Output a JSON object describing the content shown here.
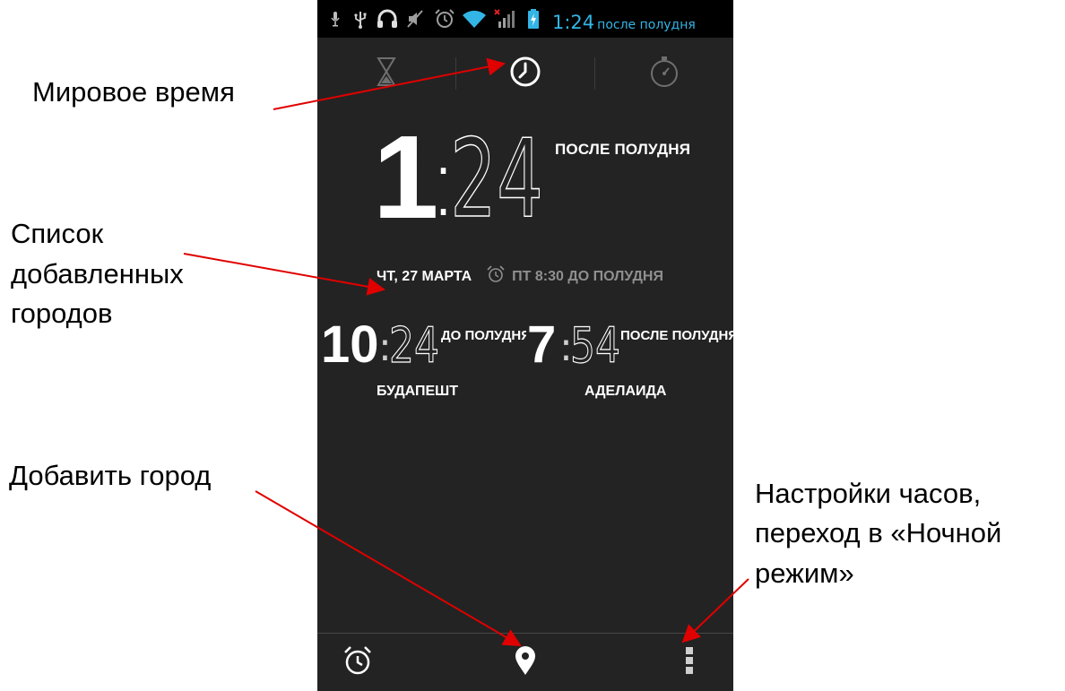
{
  "status_bar": {
    "time": "1:24",
    "ampm": "после полудня",
    "icons": [
      "mic-icon",
      "usb-icon",
      "headphones-icon",
      "mute-icon",
      "alarm-icon",
      "wifi-icon",
      "signal-icon",
      "battery-icon"
    ]
  },
  "tabs": [
    {
      "name": "timer",
      "icon": "hourglass-icon"
    },
    {
      "name": "clock",
      "icon": "clock-icon"
    },
    {
      "name": "stopwatch",
      "icon": "stopwatch-icon"
    }
  ],
  "clock": {
    "hour": "1",
    "separator": ":",
    "minutes": "24",
    "ampm": "ПОСЛЕ ПОЛУДНЯ",
    "date": "ЧТ, 27 МАРТА",
    "next_alarm": "ПТ 8:30 ДО ПОЛУДНЯ"
  },
  "cities": [
    {
      "hour": "10",
      "minutes": "24",
      "ampm": "ДО ПОЛУДНЯ",
      "name": "БУДАПЕШТ"
    },
    {
      "hour": "7",
      "minutes": "54",
      "ampm": "ПОСЛЕ ПОЛУДНЯ",
      "name": "АДЕЛАИДА"
    }
  ],
  "bottom_bar": [
    "alarm-icon",
    "location-pin-icon",
    "overflow-menu-icon"
  ],
  "callouts": {
    "world_time": "Мировое время",
    "cities_list_1": "Список",
    "cities_list_2": "добавленных",
    "cities_list_3": "городов",
    "add_city": "Добавить город",
    "settings_1": "Настройки часов,",
    "settings_2": "переход в «Ночной",
    "settings_3": "режим»"
  },
  "colors": {
    "screen_bg": "#232323",
    "status_bar_bg": "#000000",
    "accent_blue": "#33b5e5",
    "arrow_red": "#e00000",
    "muted_text": "#8f8f8f"
  }
}
